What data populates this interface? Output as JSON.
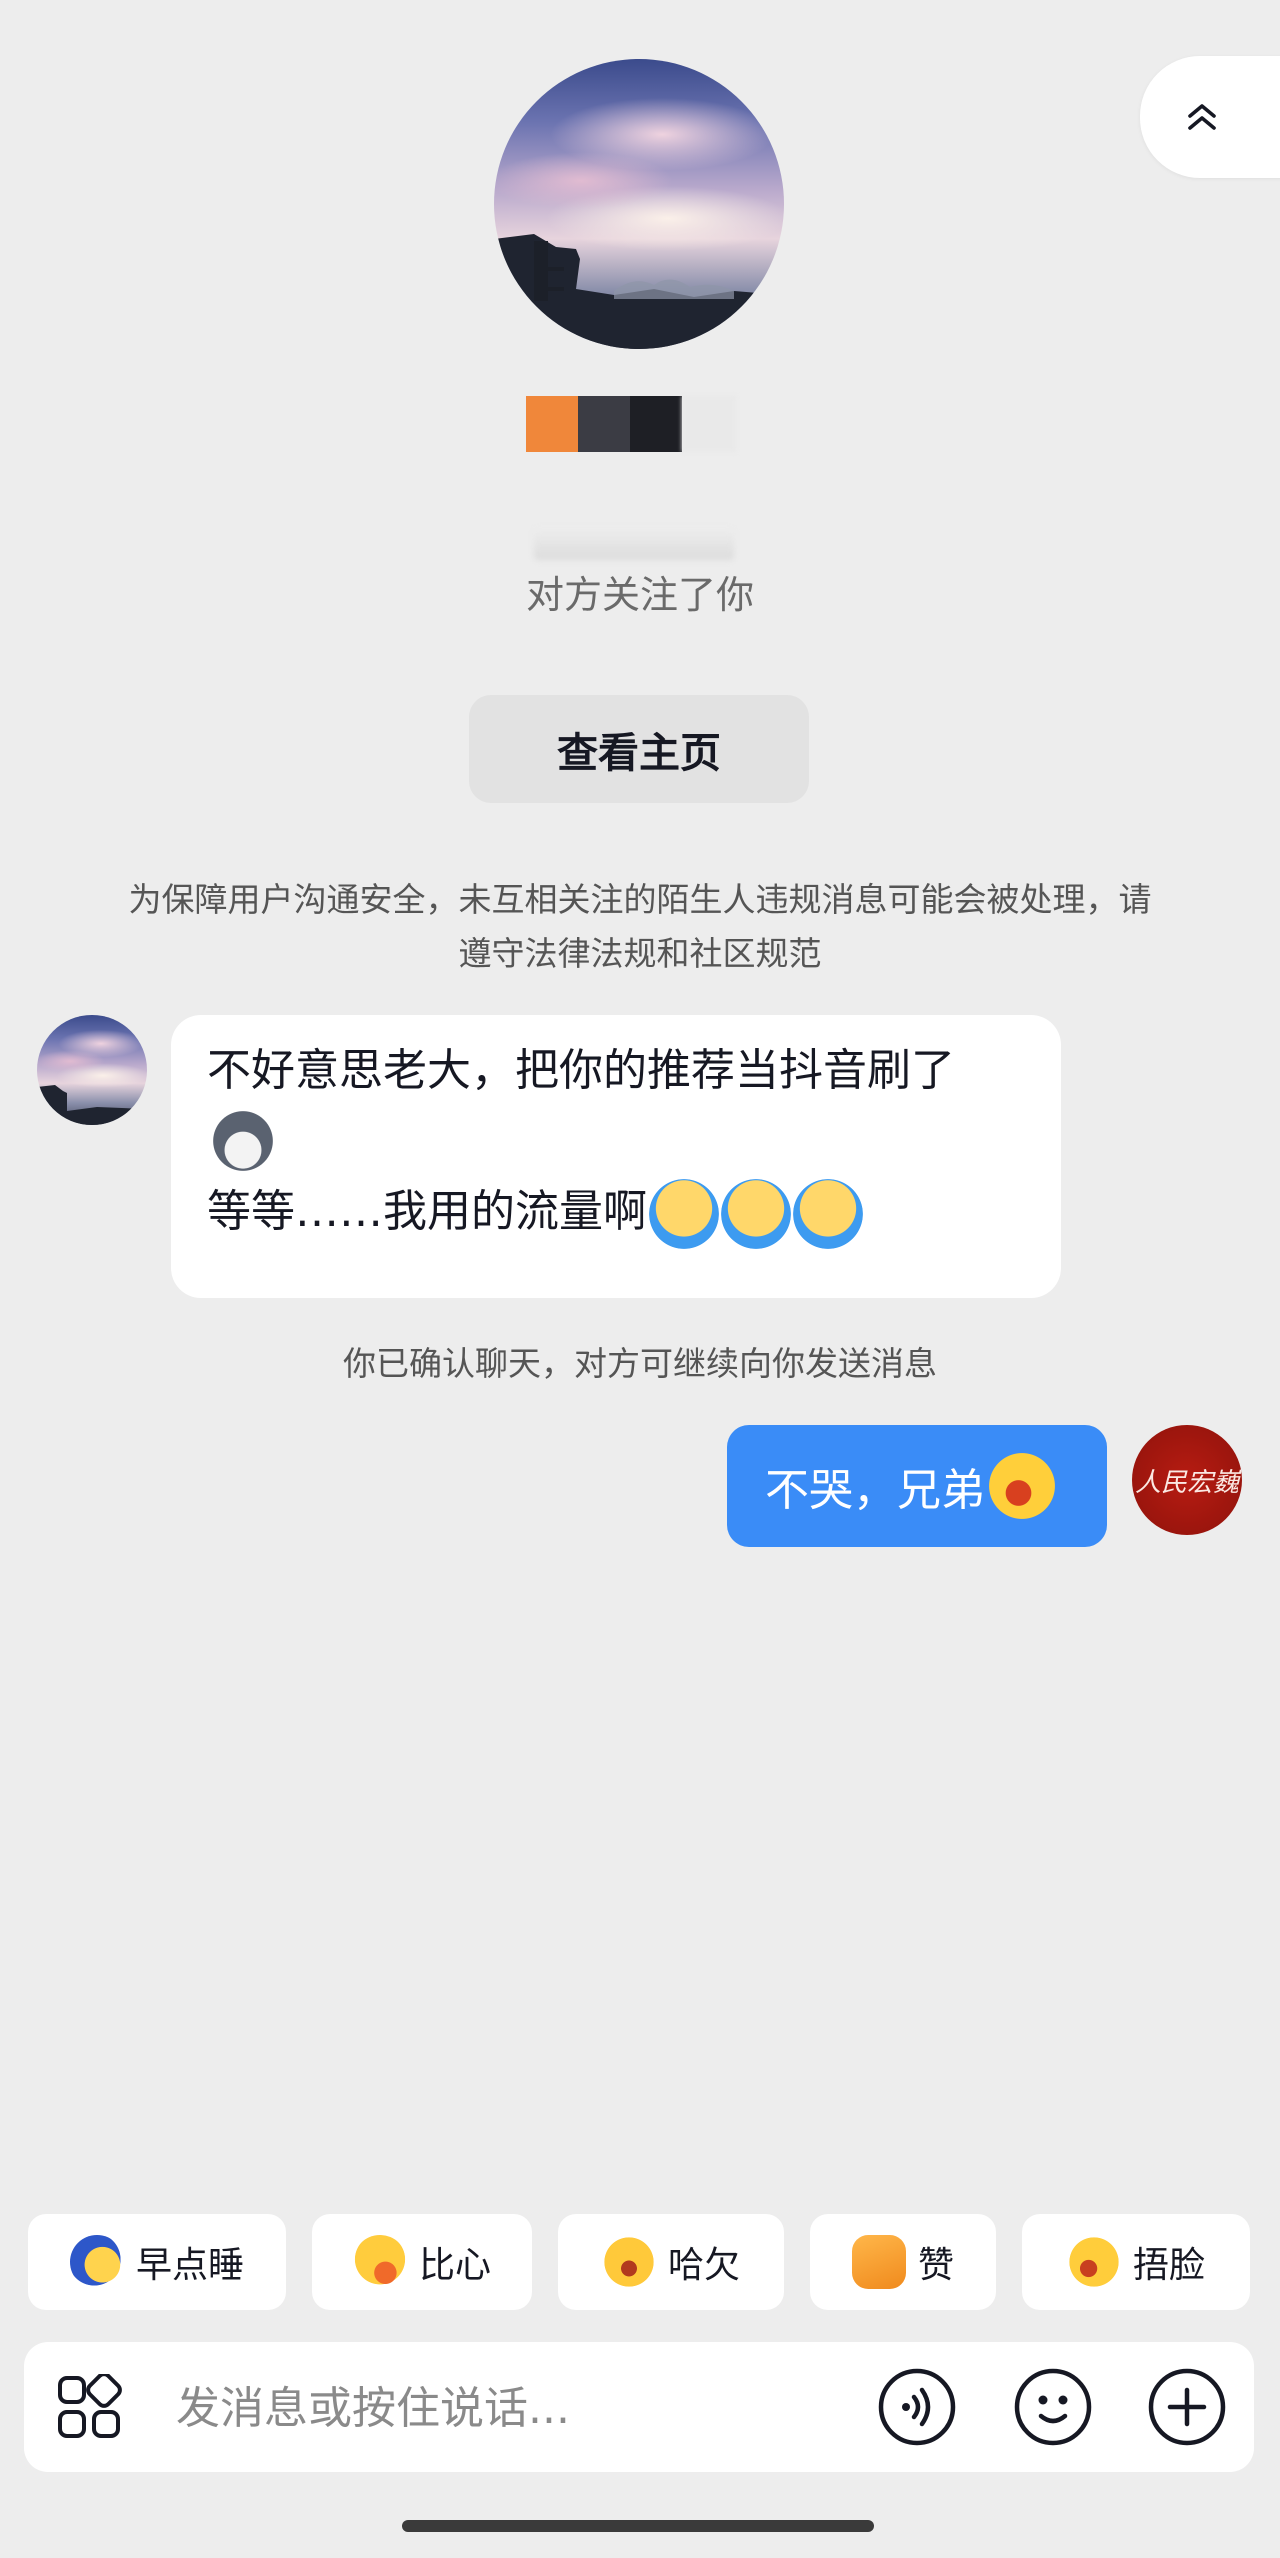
{
  "header": {
    "collapse_icon": "chevron-double-up-icon"
  },
  "profile": {
    "avatar_icon": "sunset-sky-avatar",
    "name_redacted_colors": [
      "#f0873a",
      "#3b3c44",
      "#1e1f25",
      "#e9e9e9"
    ],
    "follow_status": "对方关注了你",
    "view_profile_label": "查看主页"
  },
  "notices": {
    "safety": "为保障用户沟通安全，未互相关注的陌生人违规消息可能会被处理，请遵守法律法规和社区规范",
    "confirm": "你已确认聊天，对方可继续向你发送消息"
  },
  "messages": [
    {
      "direction": "incoming",
      "line1": "不好意思老大，把你的推荐当抖音刷了",
      "line1_emoji": "wolf-emoji",
      "line2": "等等……我用的流量啊",
      "line2_emoji": [
        "crying-emoji",
        "crying-emoji",
        "crying-emoji"
      ]
    },
    {
      "direction": "outgoing",
      "text": "不哭，兄弟",
      "emoji": "laugh-cry-emoji",
      "avatar_text": "人民宏巍"
    }
  ],
  "quick_replies": [
    {
      "label": "早点睡",
      "icon": "sleepy-moon-icon"
    },
    {
      "label": "比心",
      "icon": "finger-heart-icon"
    },
    {
      "label": "哈欠",
      "icon": "yawn-icon"
    },
    {
      "label": "赞",
      "icon": "thumbs-up-icon"
    },
    {
      "label": "捂脸",
      "icon": "facepalm-icon"
    }
  ],
  "input": {
    "placeholder": "发消息或按住说话...",
    "value": "",
    "icons": [
      "apps-grid-icon",
      "voice-icon",
      "emoji-face-icon",
      "plus-icon"
    ]
  },
  "colors": {
    "background": "#ededed",
    "outgoing_bubble": "#3a8cf7",
    "incoming_bubble": "#ffffff"
  }
}
